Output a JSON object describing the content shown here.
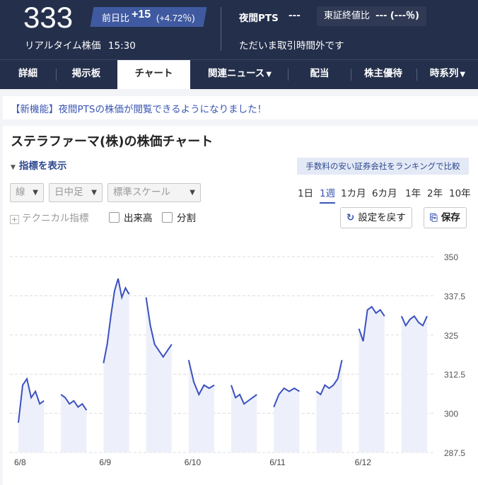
{
  "header": {
    "price": "333",
    "change_label": "前日比",
    "change_value": "+15",
    "change_pct": "(+4.72％)",
    "realtime_label": "リアルタイム株価",
    "realtime_time": "15:30",
    "pts_label": "夜間PTS",
    "pts_value": "---",
    "tse_label": "東証終値比",
    "tse_value": "--- (---％)",
    "closed_text": "ただいま取引時間外です"
  },
  "tabs": [
    "詳細",
    "掲示板",
    "チャート",
    "関連ニュース",
    "配当",
    "株主優待",
    "時系列"
  ],
  "active_tab": "チャート",
  "notice": "【新機能】夜間PTSの株価が閲覧できるようになりました！",
  "card": {
    "title": "ステラファーマ(株)の株価チャート",
    "indicator_toggle": "指標を表示",
    "ranking_link": "手数料の安い証券会社をランキングで比較",
    "selects": {
      "type": "線",
      "interval": "日中足",
      "scale": "標準スケール"
    },
    "ranges": [
      "1日",
      "1週",
      "1カ月",
      "6カ月",
      "1年",
      "2年",
      "10年"
    ],
    "active_range": "1週",
    "technical": "テクニカル指標",
    "volume": "出来高",
    "split": "分割",
    "reset_button": "設定を戻す",
    "save_button": "保存"
  },
  "colors": {
    "header_bg": "#242f4b",
    "accent": "#3a56b4",
    "line": "#3a50c0",
    "fill": "#edf0fa"
  },
  "chart_data": {
    "type": "line",
    "ylim": [
      287.5,
      350
    ],
    "yticks": [
      "350",
      "337.5",
      "325",
      "312.5",
      "300",
      "287.5"
    ],
    "days": [
      {
        "label": "6/8",
        "values": [
          297,
          309,
          311,
          305,
          307,
          303,
          304
        ]
      },
      {
        "label": "",
        "values": [
          306,
          305,
          303,
          304,
          302,
          303,
          301
        ]
      },
      {
        "label": "6/9",
        "values": [
          316,
          322,
          331,
          339,
          343,
          337,
          340,
          338
        ]
      },
      {
        "label": "",
        "values": [
          337,
          328,
          322,
          320,
          318,
          320,
          322
        ]
      },
      {
        "label": "6/10",
        "values": [
          317,
          310,
          306,
          309,
          308,
          309
        ]
      },
      {
        "label": "",
        "values": [
          309,
          305,
          306,
          303,
          304,
          305,
          306
        ]
      },
      {
        "label": "6/11",
        "values": [
          302,
          306,
          308,
          307,
          308,
          307
        ]
      },
      {
        "label": "",
        "values": [
          307,
          306,
          309,
          308,
          309,
          311,
          317
        ]
      },
      {
        "label": "6/12",
        "values": [
          327,
          323,
          333,
          334,
          332,
          333,
          331
        ]
      },
      {
        "label": "",
        "values": [
          331,
          328,
          330,
          331,
          329,
          328,
          331
        ]
      }
    ]
  }
}
